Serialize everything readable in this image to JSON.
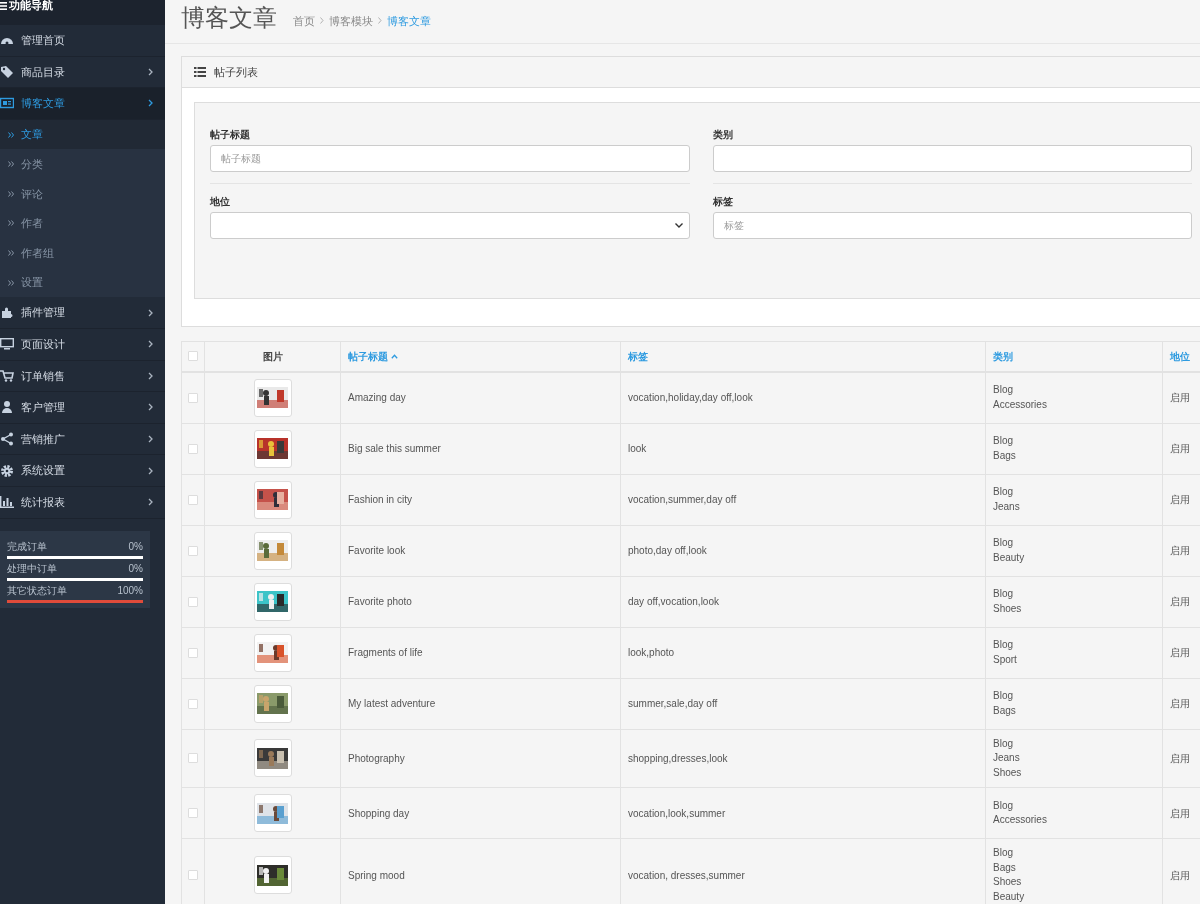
{
  "sidebar": {
    "title": "功能导航",
    "items": [
      {
        "label": "管理首页",
        "expandable": false,
        "selected": false
      },
      {
        "label": "商品目录",
        "expandable": true,
        "selected": false
      },
      {
        "label": "博客文章",
        "expandable": true,
        "selected": true,
        "children": [
          {
            "label": "文章",
            "selected": true
          },
          {
            "label": "分类",
            "selected": false
          },
          {
            "label": "评论",
            "selected": false
          },
          {
            "label": "作者",
            "selected": false
          },
          {
            "label": "作者组",
            "selected": false
          },
          {
            "label": "设置",
            "selected": false
          }
        ]
      },
      {
        "label": "插件管理",
        "expandable": true,
        "selected": false
      },
      {
        "label": "页面设计",
        "expandable": true,
        "selected": false
      },
      {
        "label": "订单销售",
        "expandable": true,
        "selected": false
      },
      {
        "label": "客户管理",
        "expandable": true,
        "selected": false
      },
      {
        "label": "营销推广",
        "expandable": true,
        "selected": false
      },
      {
        "label": "系统设置",
        "expandable": true,
        "selected": false
      },
      {
        "label": "统计报表",
        "expandable": true,
        "selected": false
      }
    ],
    "stats": [
      {
        "label": "完成订单",
        "reading": "0%",
        "level": 0
      },
      {
        "label": "处理中订单",
        "reading": "0%",
        "level": 0
      },
      {
        "label": "其它状态订单",
        "reading": "100%",
        "level": 1
      }
    ]
  },
  "page": {
    "title": "博客文章",
    "breadcrumb": [
      {
        "label": "首页",
        "selected": false
      },
      {
        "label": "博客模块",
        "selected": false
      },
      {
        "label": "博客文章",
        "selected": true
      }
    ]
  },
  "panel": {
    "title": "帖子列表",
    "filters": [
      {
        "label": "帖子标题",
        "kind": "input",
        "placeholder": "帖子标题"
      },
      {
        "label": "类别",
        "kind": "input"
      },
      {
        "label": "地位",
        "kind": "select"
      },
      {
        "label": "标签",
        "kind": "input",
        "placeholder": "标签"
      }
    ]
  },
  "table": {
    "columns": [
      {
        "label": "图片",
        "sortable": false,
        "sorted": false
      },
      {
        "label": "帖子标题",
        "sortable": true,
        "sorted": true
      },
      {
        "label": "标签",
        "sortable": true,
        "sorted": false
      },
      {
        "label": "类别",
        "sortable": true,
        "sorted": false
      },
      {
        "label": "地位",
        "sortable": true,
        "sorted": false
      }
    ],
    "select_all": {
      "checked": false
    },
    "rows": [
      {
        "checked": false,
        "title": "Amazing day",
        "tags": "vocation,holiday,day off,look",
        "categories": [
          "Blog",
          "Accessories"
        ],
        "status": "启用"
      },
      {
        "checked": false,
        "title": "Big sale this summer",
        "tags": "look",
        "categories": [
          "Blog",
          "Bags"
        ],
        "status": "启用"
      },
      {
        "checked": false,
        "title": "Fashion in city",
        "tags": "vocation,summer,day off",
        "categories": [
          "Blog",
          "Jeans"
        ],
        "status": "启用"
      },
      {
        "checked": false,
        "title": "Favorite look",
        "tags": "photo,day off,look",
        "categories": [
          "Blog",
          "Beauty"
        ],
        "status": "启用"
      },
      {
        "checked": false,
        "title": "Favorite photo",
        "tags": "day off,vocation,look",
        "categories": [
          "Blog",
          "Shoes"
        ],
        "status": "启用"
      },
      {
        "checked": false,
        "title": "Fragments of life",
        "tags": "look,photo",
        "categories": [
          "Blog",
          "Sport"
        ],
        "status": "启用"
      },
      {
        "checked": false,
        "title": "My latest adventure",
        "tags": "summer,sale,day off",
        "categories": [
          "Blog",
          "Bags"
        ],
        "status": "启用"
      },
      {
        "checked": false,
        "title": "Photography",
        "tags": "shopping,dresses,look",
        "categories": [
          "Blog",
          "Jeans",
          "Shoes"
        ],
        "status": "启用"
      },
      {
        "checked": false,
        "title": "Shopping day",
        "tags": "vocation,look,summer",
        "categories": [
          "Blog",
          "Accessories"
        ],
        "status": "启用"
      },
      {
        "checked": false,
        "title": "Spring mood",
        "tags": "vocation, dresses,summer",
        "categories": [
          "Blog",
          "Bags",
          "Shoes",
          "Beauty"
        ],
        "status": "启用"
      }
    ]
  }
}
